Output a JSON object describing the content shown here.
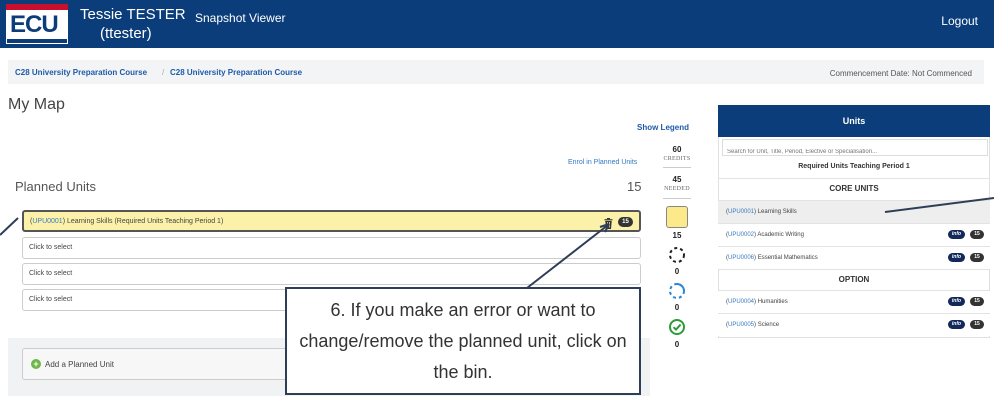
{
  "header": {
    "logo_text": "ECU",
    "user_name": "Tessie TESTER",
    "user_id": "(ttester)",
    "nav_link": "Snapshot Viewer",
    "logout": "Logout",
    "bar_color": "#0a3d7a"
  },
  "breadcrumb": {
    "items": [
      "C28 University Preparation Course",
      "C28 University Preparation Course"
    ],
    "separator": "/",
    "commencement": "Commencement Date: Not Commenced"
  },
  "map": {
    "title": "My Map",
    "show_legend": "Show Legend",
    "enrol_link": "Enrol in Planned Units",
    "planned_title": "Planned Units",
    "planned_count": "15",
    "selected_unit": {
      "code": "UPU0001",
      "title": "Learning Skills (Required Units Teaching Period 1)",
      "credits": "15"
    },
    "placeholder_rows": [
      "Click to select",
      "Click to select",
      "Click to select"
    ],
    "add_unit": "Add a Planned Unit"
  },
  "credits": {
    "credits_value": "60",
    "credits_label": "CREDITS",
    "needed_value": "45",
    "needed_label": "NEEDED",
    "planned_value": "15",
    "status_values": [
      "0",
      "0",
      "0"
    ]
  },
  "callout": {
    "text": "6. If you make an error or want to change/remove the planned unit, click on the bin."
  },
  "units_panel": {
    "title": "Units",
    "search_placeholder": "Search for Unit, Title, Period, Elective or Specialisation...",
    "period_title": "Required Units Teaching Period 1",
    "core_heading": "CORE UNITS",
    "option_heading": "OPTION",
    "info_label": "info",
    "core": [
      {
        "code": "UPU0001",
        "title": "Learning Skills"
      },
      {
        "code": "UPU0002",
        "title": "Academic Writing",
        "credits": "15"
      },
      {
        "code": "UPU0006",
        "title": "Essential Mathematics",
        "credits": "15"
      }
    ],
    "option": [
      {
        "code": "UPU0004",
        "title": "Humanities",
        "credits": "15"
      },
      {
        "code": "UPU0005",
        "title": "Science",
        "credits": "15"
      }
    ]
  }
}
